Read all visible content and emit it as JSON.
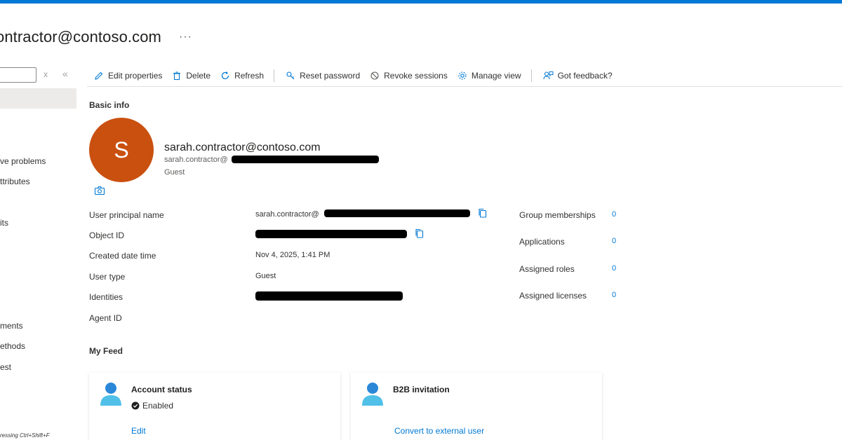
{
  "header": {
    "title": "ontractor@contoso.com",
    "more": "···"
  },
  "nav": {
    "items": [
      "ve problems",
      "ttributes",
      "its",
      "ments",
      "ethods",
      "est"
    ],
    "hint": "ressing Ctrl+Shift+F",
    "clear_icon": "x",
    "collapse_icon": "«"
  },
  "toolbar": {
    "edit": "Edit properties",
    "delete": "Delete",
    "refresh": "Refresh",
    "reset_password": "Reset password",
    "revoke_sessions": "Revoke sessions",
    "manage_view": "Manage view",
    "feedback": "Got feedback?"
  },
  "basic_info": {
    "title": "Basic info",
    "avatar_letter": "S",
    "avatar_color": "#ca5010",
    "display_name": "sarah.contractor@contoso.com",
    "sub_name": "sarah.contractor@",
    "user_type": "Guest"
  },
  "properties": [
    {
      "label": "User principal name",
      "value": "sarah.contractor@"
    },
    {
      "label": "Object ID",
      "value": ""
    },
    {
      "label": "Created date time",
      "value": "Nov 4, 2025, 1:41 PM"
    },
    {
      "label": "User type",
      "value": "Guest"
    },
    {
      "label": "Identities",
      "value": ""
    },
    {
      "label": "Agent ID",
      "value": ""
    }
  ],
  "stats": [
    {
      "label": "Group memberships",
      "value": "0"
    },
    {
      "label": "Applications",
      "value": "0"
    },
    {
      "label": "Assigned roles",
      "value": "0"
    },
    {
      "label": "Assigned licenses",
      "value": "0"
    }
  ],
  "feed": {
    "title": "My Feed",
    "cards": [
      {
        "title": "Account status",
        "status": "Enabled",
        "link": "Edit"
      },
      {
        "title": "B2B invitation",
        "link": "Convert to external user"
      }
    ]
  },
  "colors": {
    "accent": "#0078d4",
    "link": "#0078d4"
  }
}
